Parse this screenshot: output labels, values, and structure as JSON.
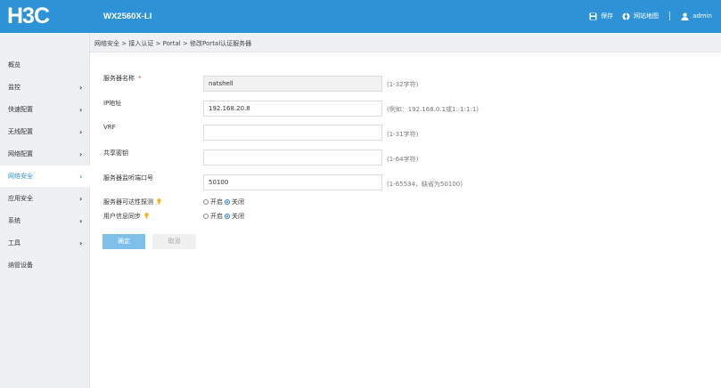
{
  "header": {
    "logo": "H3C",
    "model": "WX2560X-LI",
    "save": "保存",
    "sitemap": "网站地图",
    "user": "admin"
  },
  "breadcrumb": "网络安全 > 接入认证 > Portal > 修改Portal认证服务器",
  "sidebar": {
    "items": [
      {
        "label": "概览",
        "chevron": ""
      },
      {
        "label": "监控",
        "chevron": "›"
      },
      {
        "label": "快速配置",
        "chevron": "›"
      },
      {
        "label": "无线配置",
        "chevron": "›"
      },
      {
        "label": "网络配置",
        "chevron": "›"
      },
      {
        "label": "网络安全",
        "chevron": "›"
      },
      {
        "label": "应用安全",
        "chevron": "›"
      },
      {
        "label": "系统",
        "chevron": "›"
      },
      {
        "label": "工具",
        "chevron": "›"
      },
      {
        "label": "纳管设备",
        "chevron": ""
      }
    ],
    "active_index": 5
  },
  "form": {
    "server_name": {
      "label": "服务器名称",
      "required_mark": "*",
      "value": "natshell",
      "hint": "(1-32字符)"
    },
    "ip": {
      "label": "IP地址",
      "value": "192.168.20.8",
      "hint": "(例如：192.168.0.1或1::1:1:1)"
    },
    "vrf": {
      "label": "VRF",
      "value": "",
      "hint": "(1-31字符)"
    },
    "key": {
      "label": "共享密钥",
      "value": "",
      "hint": "(1-64字符)"
    },
    "port": {
      "label": "服务器监听端口号",
      "value": "50100",
      "hint": "(1-65534，缺省为50100)"
    },
    "reachability": {
      "label": "服务器可达性探测",
      "opt_on": "开启",
      "opt_off": "关闭",
      "selected": "off"
    },
    "user_sync": {
      "label": "用户信息同步",
      "opt_on": "开启",
      "opt_off": "关闭",
      "selected": "off"
    }
  },
  "buttons": {
    "ok": "确定",
    "cancel": "取消"
  },
  "colors": {
    "brand": "#2e92d6",
    "required": "#e03a3a",
    "bulb": "#f3b51a"
  }
}
